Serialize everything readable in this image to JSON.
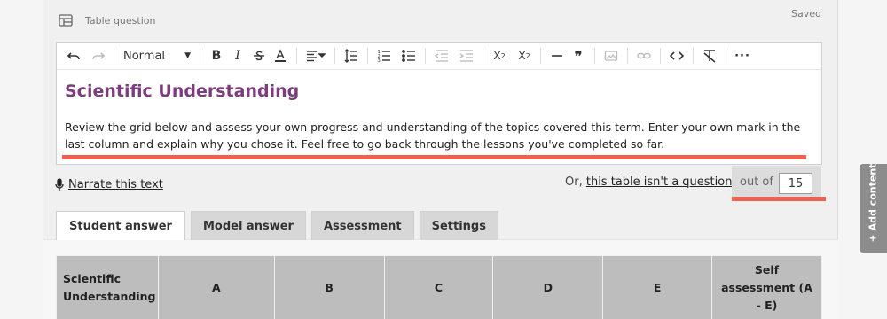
{
  "header": {
    "label": "Table question",
    "status": "Saved",
    "icon": "table-icon"
  },
  "toolbar": {
    "format_label": "Normal"
  },
  "editor": {
    "title": "Scientific Understanding",
    "body": "Review the grid below and assess your own progress and understanding of the topics covered this term. Enter your own mark in the last column and explain why you chose it. Feel free to go back through the lessons you've completed so far."
  },
  "narrate": {
    "label": "Narrate this text",
    "icon": "microphone-icon"
  },
  "question_toggle": {
    "prefix": "Or,",
    "link": "this table isn't a question."
  },
  "out_of": {
    "label": "out of",
    "value": "15"
  },
  "tabs": [
    {
      "label": "Student answer",
      "active": true
    },
    {
      "label": "Model answer",
      "active": false
    },
    {
      "label": "Assessment",
      "active": false
    },
    {
      "label": "Settings",
      "active": false
    }
  ],
  "table": {
    "headers": [
      "Scientific Understanding",
      "A",
      "B",
      "C",
      "D",
      "E",
      "Self assessment (A - E)"
    ]
  },
  "side_tab": {
    "label": "Add content",
    "icon": "plus-icon"
  },
  "colors": {
    "title_purple": "#7b3d7b",
    "highlight_red": "#f1604f",
    "header_grey": "#bdbdbd"
  }
}
